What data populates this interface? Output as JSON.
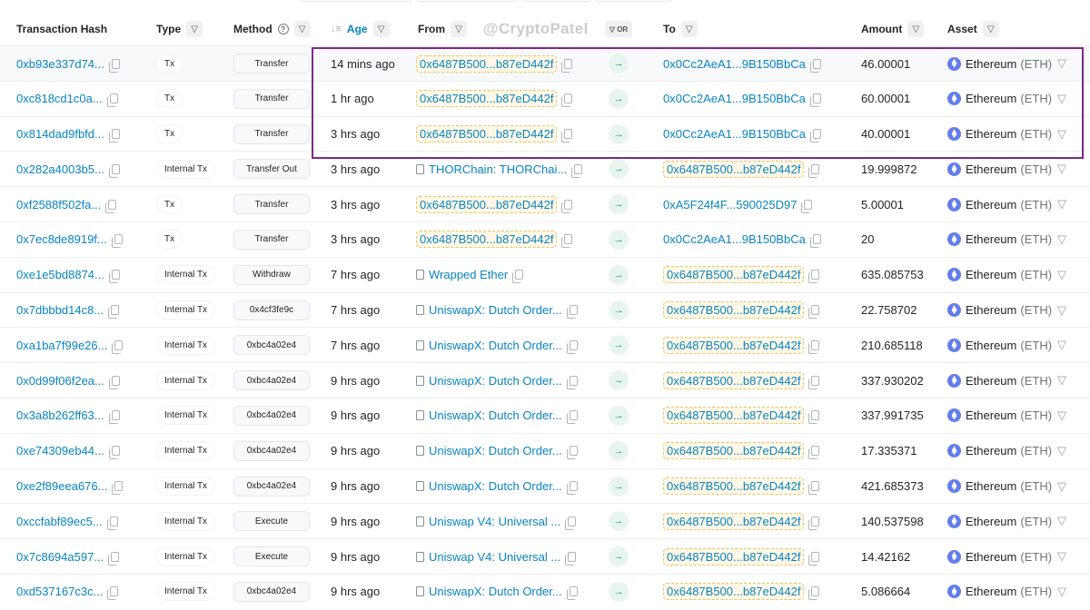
{
  "watermark": "@CryptoPatel",
  "headers": {
    "hash": "Transaction Hash",
    "type": "Type",
    "method": "Method",
    "age": "Age",
    "from": "From",
    "or": "OR",
    "to": "To",
    "amount": "Amount",
    "asset": "Asset"
  },
  "colors": {
    "link": "#0784c3",
    "highlight_box": "#7b2a86",
    "eth": "#627eea"
  },
  "rows": [
    {
      "hash": "0xb93e337d74...",
      "type": "Tx",
      "method": "Transfer",
      "age": "14 mins ago",
      "from": "0x6487B500...b87eD442f",
      "from_kind": "addr",
      "to": "0x0Cc2AeA1...9B150BbCa",
      "to_kind": "plain",
      "amount": "46.00001",
      "asset": "Ethereum",
      "symbol": "(ETH)"
    },
    {
      "hash": "0xc818cd1c0a...",
      "type": "Tx",
      "method": "Transfer",
      "age": "1 hr ago",
      "from": "0x6487B500...b87eD442f",
      "from_kind": "addr",
      "to": "0x0Cc2AeA1...9B150BbCa",
      "to_kind": "plain",
      "amount": "60.00001",
      "asset": "Ethereum",
      "symbol": "(ETH)"
    },
    {
      "hash": "0x814dad9fbfd...",
      "type": "Tx",
      "method": "Transfer",
      "age": "3 hrs ago",
      "from": "0x6487B500...b87eD442f",
      "from_kind": "addr",
      "to": "0x0Cc2AeA1...9B150BbCa",
      "to_kind": "plain",
      "amount": "40.00001",
      "asset": "Ethereum",
      "symbol": "(ETH)"
    },
    {
      "hash": "0x282a4003b5...",
      "type": "Internal Tx",
      "method": "Transfer Out",
      "age": "3 hrs ago",
      "from": "THORChain: THORChai...",
      "from_kind": "contract",
      "to": "0x6487B500...b87eD442f",
      "to_kind": "addr",
      "amount": "19.999872",
      "asset": "Ethereum",
      "symbol": "(ETH)"
    },
    {
      "hash": "0xf2588f502fa...",
      "type": "Tx",
      "method": "Transfer",
      "age": "3 hrs ago",
      "from": "0x6487B500...b87eD442f",
      "from_kind": "addr",
      "to": "0xA5F24f4F...590025D97",
      "to_kind": "plain",
      "amount": "5.00001",
      "asset": "Ethereum",
      "symbol": "(ETH)"
    },
    {
      "hash": "0x7ec8de8919f...",
      "type": "Tx",
      "method": "Transfer",
      "age": "3 hrs ago",
      "from": "0x6487B500...b87eD442f",
      "from_kind": "addr",
      "to": "0x0Cc2AeA1...9B150BbCa",
      "to_kind": "plain",
      "amount": "20",
      "asset": "Ethereum",
      "symbol": "(ETH)"
    },
    {
      "hash": "0xe1e5bd8874...",
      "type": "Internal Tx",
      "method": "Withdraw",
      "age": "7 hrs ago",
      "from": "Wrapped Ether",
      "from_kind": "contract",
      "to": "0x6487B500...b87eD442f",
      "to_kind": "addr",
      "amount": "635.085753",
      "asset": "Ethereum",
      "symbol": "(ETH)"
    },
    {
      "hash": "0x7dbbbd14c8...",
      "type": "Internal Tx",
      "method": "0x4cf3fe9c",
      "age": "7 hrs ago",
      "from": "UniswapX: Dutch Order...",
      "from_kind": "contract",
      "to": "0x6487B500...b87eD442f",
      "to_kind": "addr",
      "amount": "22.758702",
      "asset": "Ethereum",
      "symbol": "(ETH)"
    },
    {
      "hash": "0xa1ba7f99e26...",
      "type": "Internal Tx",
      "method": "0xbc4a02e4",
      "age": "7 hrs ago",
      "from": "UniswapX: Dutch Order...",
      "from_kind": "contract",
      "to": "0x6487B500...b87eD442f",
      "to_kind": "addr",
      "amount": "210.685118",
      "asset": "Ethereum",
      "symbol": "(ETH)"
    },
    {
      "hash": "0x0d99f06f2ea...",
      "type": "Internal Tx",
      "method": "0xbc4a02e4",
      "age": "9 hrs ago",
      "from": "UniswapX: Dutch Order...",
      "from_kind": "contract",
      "to": "0x6487B500...b87eD442f",
      "to_kind": "addr",
      "amount": "337.930202",
      "asset": "Ethereum",
      "symbol": "(ETH)"
    },
    {
      "hash": "0x3a8b262ff63...",
      "type": "Internal Tx",
      "method": "0xbc4a02e4",
      "age": "9 hrs ago",
      "from": "UniswapX: Dutch Order...",
      "from_kind": "contract",
      "to": "0x6487B500...b87eD442f",
      "to_kind": "addr",
      "amount": "337.991735",
      "asset": "Ethereum",
      "symbol": "(ETH)"
    },
    {
      "hash": "0xe74309eb44...",
      "type": "Internal Tx",
      "method": "0xbc4a02e4",
      "age": "9 hrs ago",
      "from": "UniswapX: Dutch Order...",
      "from_kind": "contract",
      "to": "0x6487B500...b87eD442f",
      "to_kind": "addr",
      "amount": "17.335371",
      "asset": "Ethereum",
      "symbol": "(ETH)"
    },
    {
      "hash": "0xe2f89eea676...",
      "type": "Internal Tx",
      "method": "0xbc4a02e4",
      "age": "9 hrs ago",
      "from": "UniswapX: Dutch Order...",
      "from_kind": "contract",
      "to": "0x6487B500...b87eD442f",
      "to_kind": "addr",
      "amount": "421.685373",
      "asset": "Ethereum",
      "symbol": "(ETH)"
    },
    {
      "hash": "0xccfabf89ec5...",
      "type": "Internal Tx",
      "method": "Execute",
      "age": "9 hrs ago",
      "from": "Uniswap V4: Universal ...",
      "from_kind": "contract",
      "to": "0x6487B500...b87eD442f",
      "to_kind": "addr",
      "amount": "140.537598",
      "asset": "Ethereum",
      "symbol": "(ETH)"
    },
    {
      "hash": "0x7c8694a597...",
      "type": "Internal Tx",
      "method": "Execute",
      "age": "9 hrs ago",
      "from": "Uniswap V4: Universal ...",
      "from_kind": "contract",
      "to": "0x6487B500...b87eD442f",
      "to_kind": "addr",
      "amount": "14.42162",
      "asset": "Ethereum",
      "symbol": "(ETH)"
    },
    {
      "hash": "0xd537167c3c...",
      "type": "Internal Tx",
      "method": "0xbc4a02e4",
      "age": "9 hrs ago",
      "from": "UniswapX: Dutch Order...",
      "from_kind": "contract",
      "to": "0x6487B500...b87eD442f",
      "to_kind": "addr",
      "amount": "5.086664",
      "asset": "Ethereum",
      "symbol": "(ETH)"
    }
  ]
}
